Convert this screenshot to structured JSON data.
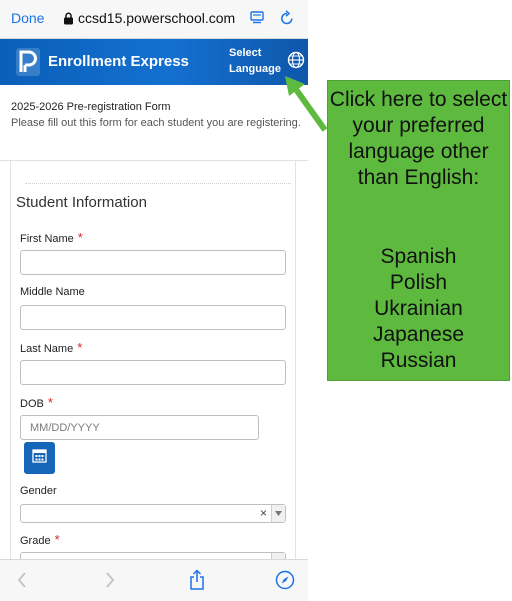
{
  "browser": {
    "done_label": "Done",
    "url": "ccsd15.powerschool.com"
  },
  "header": {
    "app_title": "Enrollment Express",
    "select_language_line1": "Select",
    "select_language_line2": "Language",
    "brand_color": "#1470d0"
  },
  "form": {
    "title": "2025-2026 Pre-registration Form",
    "description": "Please fill out this form for each student you are registering.",
    "section_title": "Student Information",
    "required_marker": "*",
    "fields": {
      "first_name_label": "First Name",
      "middle_name_label": "Middle Name",
      "last_name_label": "Last Name",
      "dob_label": "DOB",
      "dob_placeholder": "MM/DD/YYYY",
      "gender_label": "Gender",
      "gender_clear": "×",
      "grade_label": "Grade"
    }
  },
  "callout": {
    "text": "Click here to select your preferred language other than English:",
    "languages": [
      "Spanish",
      "Polish",
      "Ukrainian",
      "Japanese",
      "Russian"
    ],
    "color": "#5dba3f"
  },
  "icons": {
    "lock": "lock-icon",
    "reader": "reader-icon",
    "reload": "reload-icon",
    "globe": "globe-icon",
    "calendar": "calendar-icon",
    "back": "chevron-left-icon",
    "forward": "chevron-right-icon",
    "share": "share-icon",
    "compass": "compass-icon"
  }
}
